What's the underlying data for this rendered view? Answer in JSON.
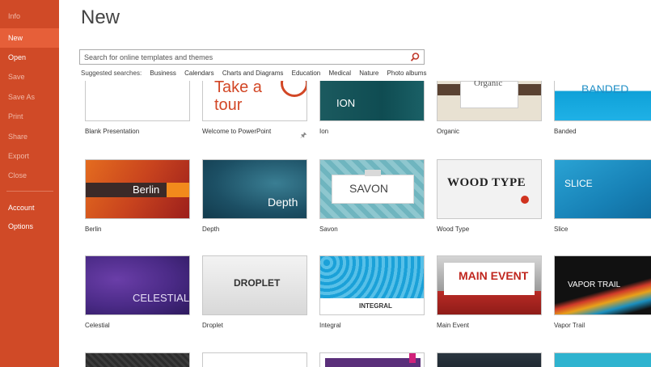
{
  "sidebar": {
    "items": [
      {
        "label": "Info"
      },
      {
        "label": "New"
      },
      {
        "label": "Open"
      },
      {
        "label": "Save"
      },
      {
        "label": "Save As"
      },
      {
        "label": "Print"
      },
      {
        "label": "Share"
      },
      {
        "label": "Export"
      },
      {
        "label": "Close"
      },
      {
        "label": "Account"
      },
      {
        "label": "Options"
      }
    ]
  },
  "main": {
    "title": "New",
    "search": {
      "placeholder": "Search for online templates and themes"
    },
    "suggested": {
      "label": "Suggested searches:",
      "links": [
        "Business",
        "Calendars",
        "Charts and Diagrams",
        "Education",
        "Medical",
        "Nature",
        "Photo albums"
      ]
    },
    "templates": [
      {
        "name": "Blank Presentation"
      },
      {
        "name": "Welcome to PowerPoint",
        "thumb_lines": [
          "Take a",
          "tour"
        ]
      },
      {
        "name": "Ion",
        "thumb_text": "ION"
      },
      {
        "name": "Organic",
        "thumb_text": "Organic"
      },
      {
        "name": "Banded",
        "thumb_text": "BANDED"
      },
      {
        "name": "Berlin",
        "thumb_text": "Berlin"
      },
      {
        "name": "Depth",
        "thumb_text": "Depth"
      },
      {
        "name": "Savon",
        "thumb_text": "SAVON"
      },
      {
        "name": "Wood Type",
        "thumb_text": "WOOD TYPE"
      },
      {
        "name": "Slice",
        "thumb_text": "SLICE"
      },
      {
        "name": "Celestial",
        "thumb_text": "CELESTIAL"
      },
      {
        "name": "Droplet",
        "thumb_text": "DROPLET"
      },
      {
        "name": "Integral",
        "thumb_text": "INTEGRAL"
      },
      {
        "name": "Main Event",
        "thumb_text": "MAIN EVENT"
      },
      {
        "name": "Vapor Trail",
        "thumb_text": "VAPOR TRAIL"
      }
    ]
  },
  "colors": {
    "sidebar": "#d04a27",
    "sidebar_active": "#e65f39"
  },
  "icons": {
    "search": "search-icon",
    "pin": "pin-icon"
  }
}
